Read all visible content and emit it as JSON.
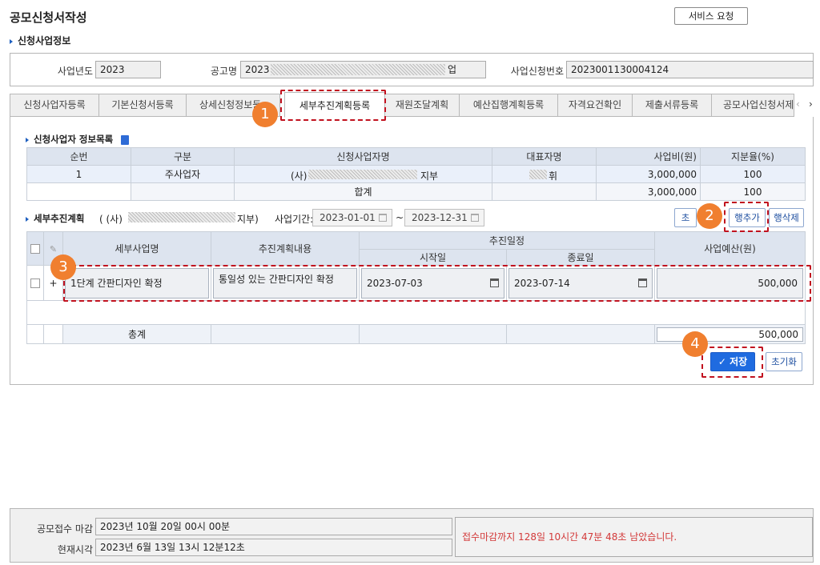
{
  "header": {
    "title": "공모신청서작성",
    "service_button": "서비스 요청"
  },
  "section_business": {
    "heading": "신청사업정보"
  },
  "info": {
    "year_label": "사업년도",
    "year_value": "2023",
    "notice_label": "공고명",
    "notice_value_start": "2023",
    "notice_value_end": "업",
    "app_no_label": "사업신청번호",
    "app_no_value": "2023001130004124"
  },
  "tabs": [
    {
      "label": "신청사업자등록"
    },
    {
      "label": "기본신청서등록"
    },
    {
      "label": "상세신청정보등"
    },
    {
      "label": "세부추진계획등록"
    },
    {
      "label": "재원조달계획"
    },
    {
      "label": "예산집행계획등록"
    },
    {
      "label": "자격요건확인"
    },
    {
      "label": "제출서류등록"
    },
    {
      "label": "공모사업신청서제"
    }
  ],
  "applicant_list": {
    "heading": "신청사업자 정보목록",
    "columns": [
      "순번",
      "구분",
      "신청사업자명",
      "대표자명",
      "사업비(원)",
      "지분율(%)"
    ],
    "rows": [
      {
        "no": "1",
        "type": "주사업자",
        "name_start": "(사)",
        "name_end": "지부",
        "rep_end": "휘",
        "cost": "3,000,000",
        "share": "100"
      }
    ],
    "sum": {
      "label": "합계",
      "cost": "3,000,000",
      "share": "100"
    }
  },
  "plan": {
    "heading": "세부추진계획",
    "org_start": "( (사)",
    "org_end": "지부)",
    "period_label": "사업기간:",
    "start": "2023-01-01",
    "tilde": "~",
    "end": "2023-12-31",
    "btn_partial": "초",
    "btn_add_row": "행추가",
    "btn_delete_row": "행삭제",
    "columns": {
      "name": "세부사업명",
      "content": "추진계획내용",
      "schedule": "추진일정",
      "start": "시작일",
      "end": "종료일",
      "budget": "사업예산(원)"
    },
    "rows": [
      {
        "marker": "+",
        "name": "1단계 간판디자인 확정",
        "content": "통일성 있는 간판디자인 확정",
        "start": "2023-07-03",
        "end": "2023-07-14",
        "budget": "500,000"
      }
    ],
    "total_label": "총계",
    "total_value": "500,000",
    "btn_save": "저장",
    "btn_reset": "초기화"
  },
  "callouts": [
    "1",
    "2",
    "3",
    "4"
  ],
  "footer": {
    "deadline_label": "공모접수 마감",
    "deadline_value": "2023년 10월 20일 00시 00분",
    "now_label": "현재시각",
    "now_value": "2023년 6월 13일 13시 12분12초",
    "remaining": "접수마감까지 128일 10시간 47분 48초 남았습니다."
  },
  "colors": {
    "accent": "#1f6be0",
    "annotation": "#c1121f",
    "badge": "#f07f2f",
    "remaining_text": "#d33a3a"
  }
}
